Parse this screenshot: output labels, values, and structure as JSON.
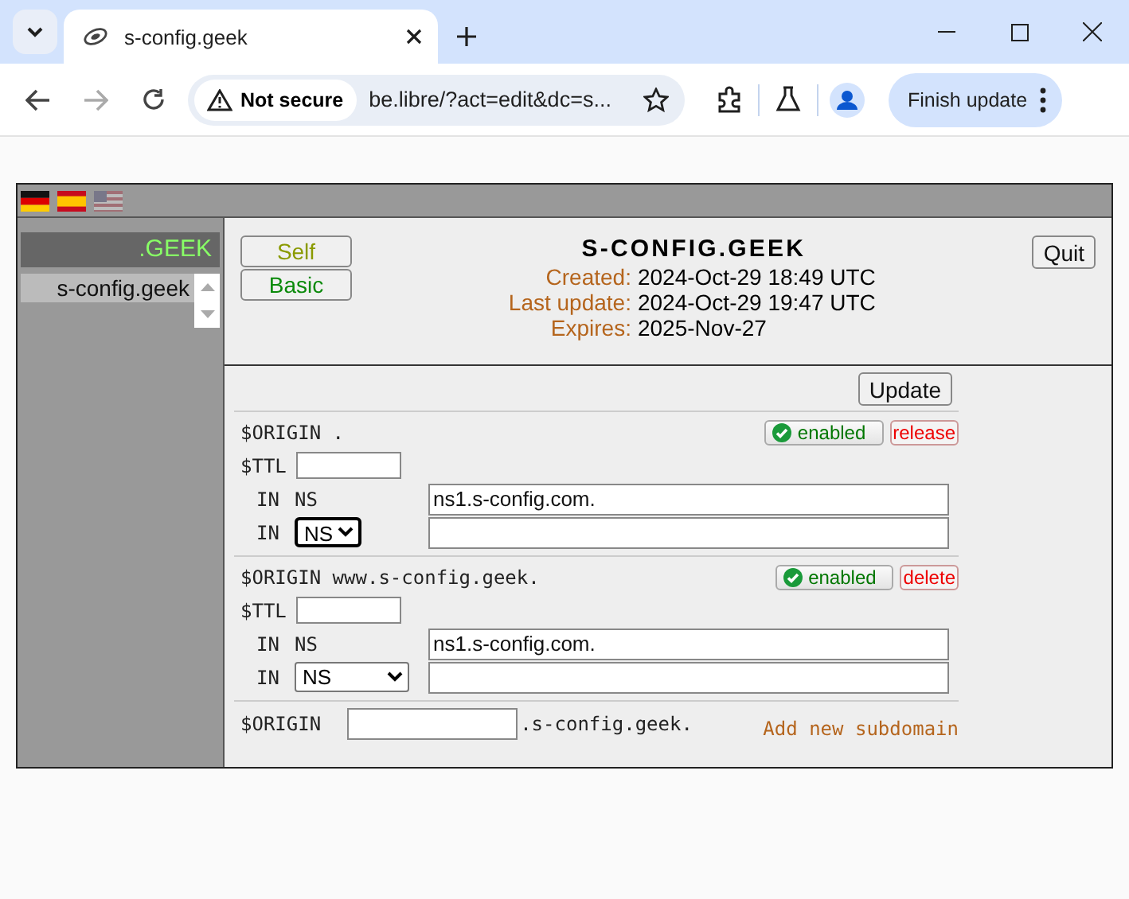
{
  "browser": {
    "tab_title": "s-config.geek",
    "security": "Not secure",
    "url": "be.libre/?act=edit&dc=s...",
    "update_button": "Finish update"
  },
  "languages": [
    {
      "kind": "de",
      "disabled": false
    },
    {
      "kind": "es",
      "disabled": false
    },
    {
      "kind": "us",
      "disabled": true
    }
  ],
  "sidebar": {
    "zone": ".GEEK",
    "domains": [
      {
        "label": "s-config.geek",
        "selected": true
      }
    ]
  },
  "header": {
    "buttons": [
      {
        "label": "Self",
        "color": "#8a9a00"
      },
      {
        "label": "Basic",
        "color": "#0a8a0a"
      }
    ],
    "title": "S-CONFIG.GEEK",
    "fields": [
      {
        "label": "Created:",
        "value": "2024-Oct-29 18:49 UTC"
      },
      {
        "label": "Last update:",
        "value": "2024-Oct-29 19:47 UTC"
      },
      {
        "label": "Expires:",
        "value": "2025-Nov-27"
      }
    ],
    "quit_button": "Quit"
  },
  "update_button": "Update",
  "origins": [
    {
      "origin": "$ORIGIN .",
      "ttl_label": "$TTL",
      "status": "enabled",
      "enabled": true,
      "action": "release",
      "records": [
        {
          "kind": "fixed",
          "class": "IN",
          "type": "NS",
          "value": "ns1.s-config.com."
        },
        {
          "kind": "new",
          "class": "IN",
          "type": "NS",
          "focused": true
        }
      ]
    },
    {
      "origin": "$ORIGIN www.s-config.geek.",
      "ttl_label": "$TTL",
      "status": "enabled",
      "enabled": true,
      "action": "delete",
      "records": [
        {
          "kind": "fixed",
          "class": "IN",
          "type": "NS",
          "value": "ns1.s-config.com."
        },
        {
          "kind": "new",
          "class": "IN",
          "type": "NS",
          "focused": false
        }
      ]
    }
  ],
  "new_subdomain": {
    "label": "$ORIGIN",
    "suffix": ".s-config.geek.",
    "link": "Add new subdomain"
  }
}
